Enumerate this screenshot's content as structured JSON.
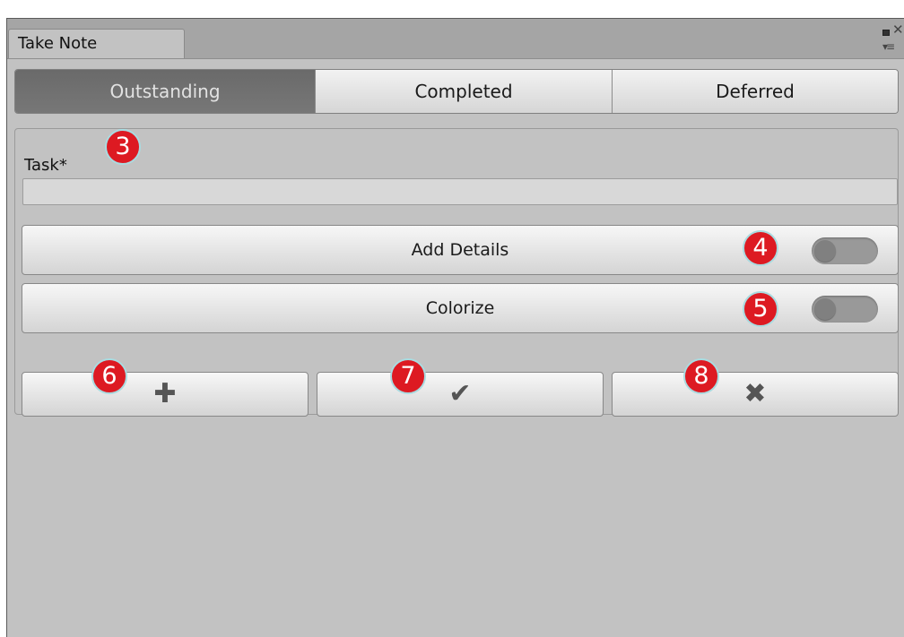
{
  "window": {
    "tab_title": "Take Note",
    "controls": {
      "maximize_icon": "maximize-icon",
      "close_icon": "close-icon",
      "menu_icon": "window-menu-icon",
      "close_glyph": "✕",
      "menu_glyph": "▾≡"
    }
  },
  "toolbar": {
    "tabs": [
      {
        "label": "Outstanding",
        "active": true
      },
      {
        "label": "Completed",
        "active": false
      },
      {
        "label": "Deferred",
        "active": false
      }
    ]
  },
  "form": {
    "task_label": "Task*",
    "task_value": "",
    "add_details": {
      "label": "Add Details",
      "toggle_on": false
    },
    "colorize": {
      "label": "Colorize",
      "toggle_on": false
    }
  },
  "actions": {
    "add": {
      "icon": "plus-icon",
      "glyph": "✚"
    },
    "complete": {
      "icon": "checkmark-icon",
      "glyph": "✔"
    },
    "delete": {
      "icon": "x-icon",
      "glyph": "✖"
    }
  },
  "annotations": [
    "3",
    "4",
    "5",
    "6",
    "7",
    "8"
  ],
  "colors": {
    "badge": "#dd1a22",
    "badge_ring": "#a9dbe0",
    "active_tab": "#6f6f6f",
    "panel_bg": "#c2c2c2"
  }
}
